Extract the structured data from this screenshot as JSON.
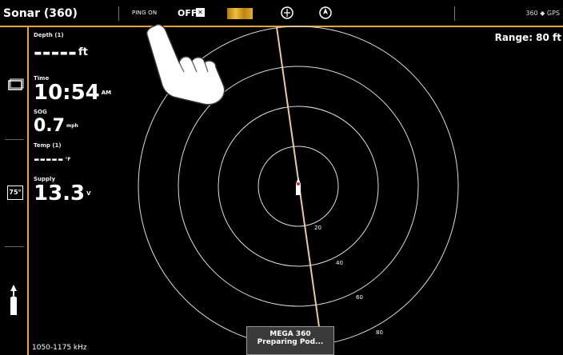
{
  "topbar": {
    "title": "Sonar (360)",
    "ping_label": "PING ON",
    "off_label": "OFF",
    "right_icons": [
      "360-icon",
      "compass-icon",
      "gps-icon"
    ],
    "accent_color": "#e6a23c"
  },
  "leftbar": {
    "items": [
      "chart-icon",
      "temp-75-icon",
      "boat-icon"
    ],
    "temp_badge": "75°"
  },
  "data": {
    "depth": {
      "label": "Depth (1)",
      "value": "-----",
      "unit": "ft"
    },
    "time": {
      "label": "Time",
      "value": "10:54",
      "unit": "AM"
    },
    "sog": {
      "label": "SOG",
      "value": "0.7",
      "unit": "mph"
    },
    "temp": {
      "label": "Temp (1)",
      "value": "-----",
      "unit": "°F"
    },
    "supply": {
      "label": "Supply",
      "value": "13.3",
      "unit": "V"
    }
  },
  "sonar": {
    "range_label": "Range: 80 ft",
    "ring_labels": [
      "20",
      "40",
      "60",
      "80"
    ],
    "frequency": "1050-1175 kHz"
  },
  "popup": {
    "line1": "MEGA 360",
    "line2": "Preparing Pod..."
  }
}
